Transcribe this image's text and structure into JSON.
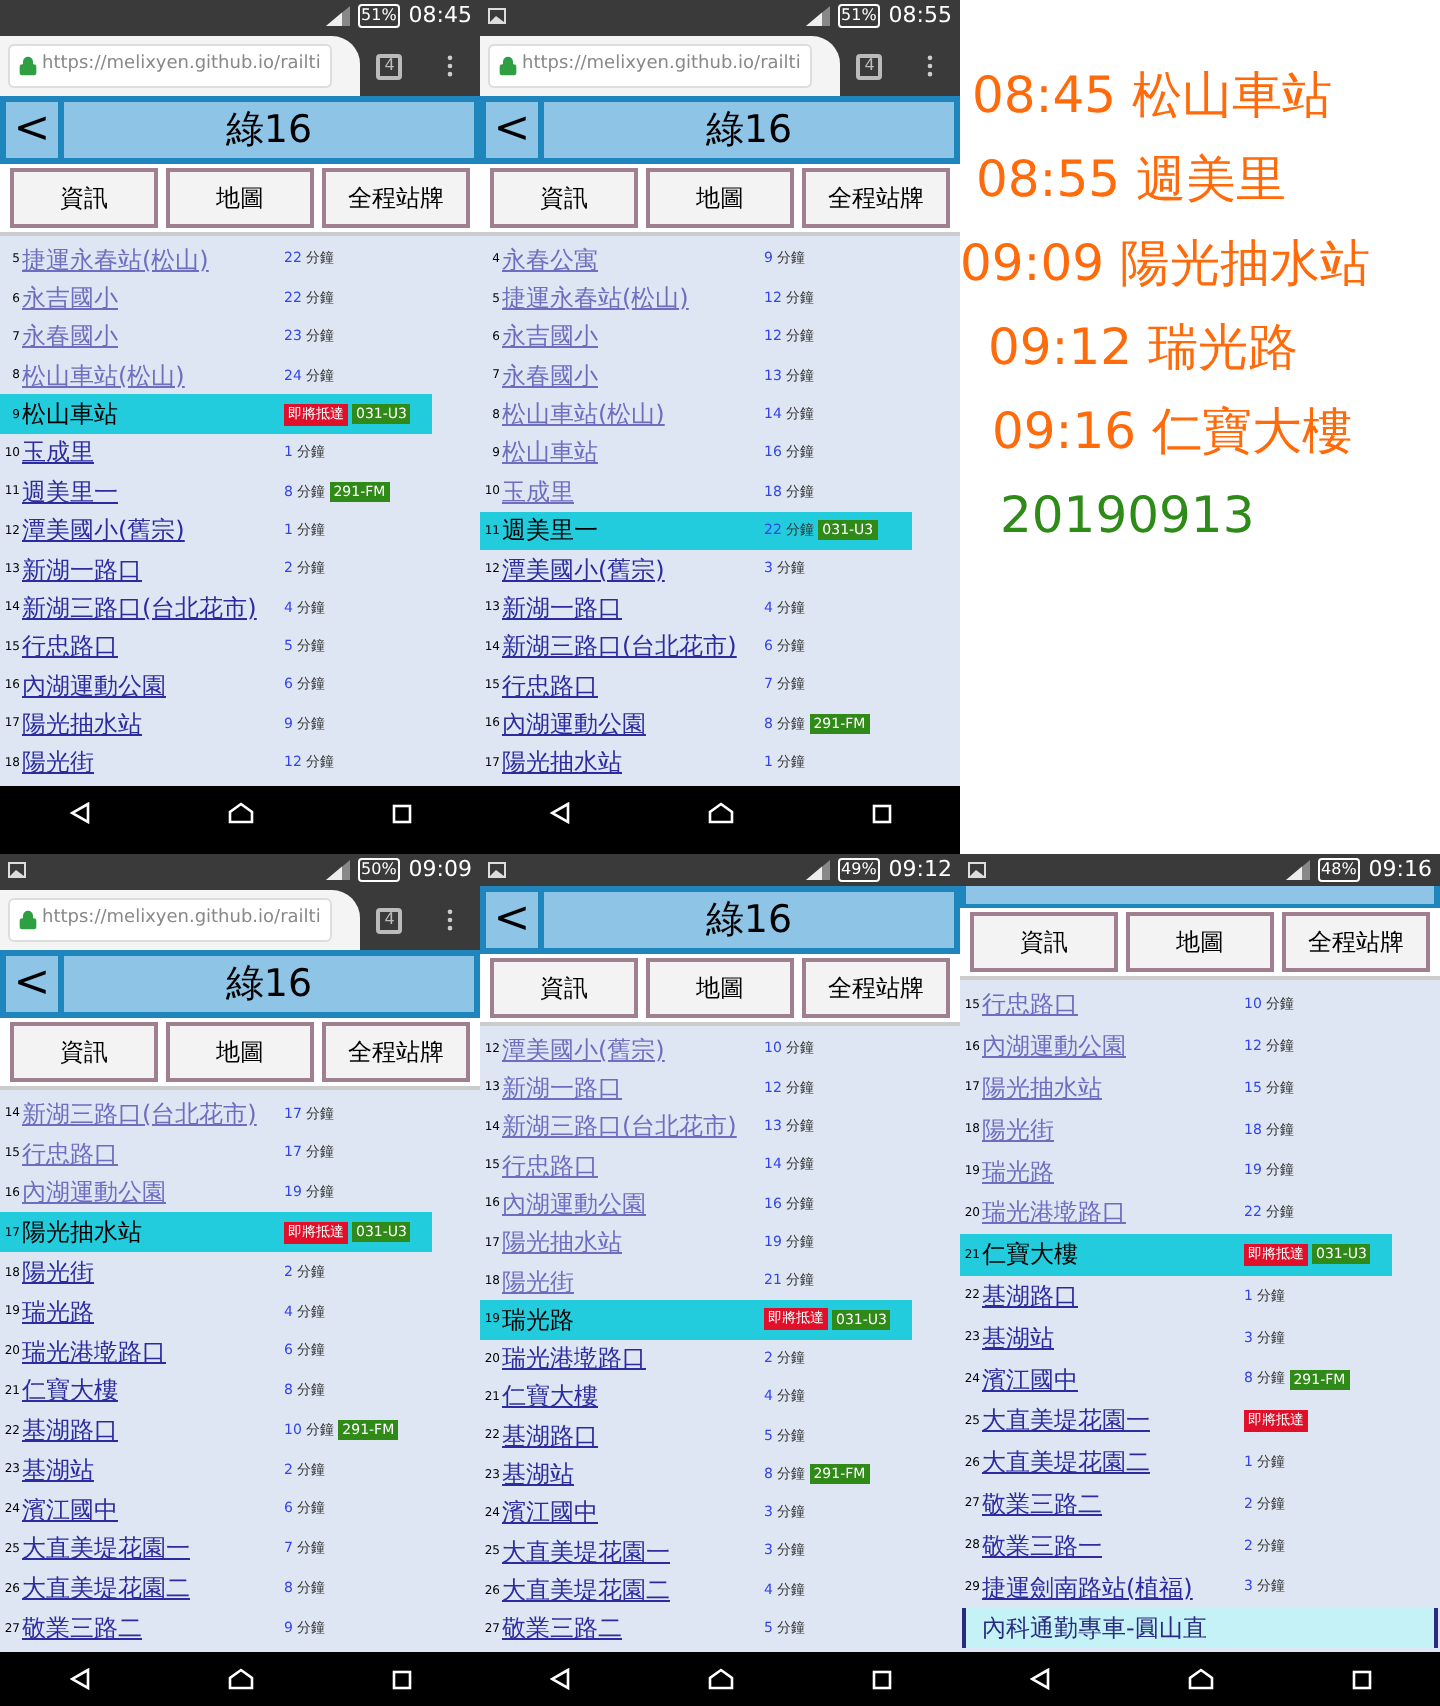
{
  "screenshots": [
    {
      "status": {
        "time": "08:45",
        "battery": "51%",
        "image_icon": false
      },
      "url_bar": {
        "url": "https://melixyen.github.io/railti",
        "tabs": "4"
      },
      "header": {
        "back": "<",
        "title": "綠16"
      },
      "buttons": [
        "資訊",
        "地圖",
        "全程站牌"
      ],
      "stops": [
        {
          "no": "5",
          "name": "捷運永春站(松山)",
          "visited": true,
          "selected": false,
          "eta": "22",
          "unit": "分鐘"
        },
        {
          "no": "6",
          "name": "永吉國小",
          "visited": true,
          "selected": false,
          "eta": "22",
          "unit": "分鐘"
        },
        {
          "no": "7",
          "name": "永春國小",
          "visited": true,
          "selected": false,
          "eta": "23",
          "unit": "分鐘"
        },
        {
          "no": "8",
          "name": "松山車站(松山)",
          "visited": true,
          "selected": false,
          "eta": "24",
          "unit": "分鐘"
        },
        {
          "no": "9",
          "name": "松山車站",
          "selected": true,
          "arriving": "即將抵達",
          "plate": "031-U3"
        },
        {
          "no": "10",
          "name": "玉成里",
          "visited": false,
          "selected": false,
          "eta": "1",
          "unit": "分鐘"
        },
        {
          "no": "11",
          "name": "週美里一",
          "visited": false,
          "selected": false,
          "eta": "8",
          "unit": "分鐘",
          "plate": "291-FM"
        },
        {
          "no": "12",
          "name": "潭美國小(舊宗)",
          "visited": false,
          "selected": false,
          "eta": "1",
          "unit": "分鐘"
        },
        {
          "no": "13",
          "name": "新湖一路口",
          "visited": false,
          "selected": false,
          "eta": "2",
          "unit": "分鐘"
        },
        {
          "no": "14",
          "name": "新湖三路口(台北花市)",
          "visited": false,
          "selected": false,
          "eta": "4",
          "unit": "分鐘"
        },
        {
          "no": "15",
          "name": "行忠路口",
          "visited": false,
          "selected": false,
          "eta": "5",
          "unit": "分鐘"
        },
        {
          "no": "16",
          "name": "內湖運動公園",
          "visited": false,
          "selected": false,
          "eta": "6",
          "unit": "分鐘"
        },
        {
          "no": "17",
          "name": "陽光抽水站",
          "visited": false,
          "selected": false,
          "eta": "9",
          "unit": "分鐘"
        },
        {
          "no": "18",
          "name": "陽光街",
          "visited": false,
          "selected": false,
          "eta": "12",
          "unit": "分鐘"
        }
      ]
    },
    {
      "status": {
        "time": "08:55",
        "battery": "51%",
        "image_icon": true
      },
      "url_bar": {
        "url": "https://melixyen.github.io/railti",
        "tabs": "4"
      },
      "header": {
        "back": "<",
        "title": "綠16"
      },
      "buttons": [
        "資訊",
        "地圖",
        "全程站牌"
      ],
      "stops": [
        {
          "no": "4",
          "name": "永春公寓",
          "visited": true,
          "selected": false,
          "eta": "9",
          "unit": "分鐘"
        },
        {
          "no": "5",
          "name": "捷運永春站(松山)",
          "visited": true,
          "selected": false,
          "eta": "12",
          "unit": "分鐘"
        },
        {
          "no": "6",
          "name": "永吉國小",
          "visited": true,
          "selected": false,
          "eta": "12",
          "unit": "分鐘"
        },
        {
          "no": "7",
          "name": "永春國小",
          "visited": true,
          "selected": false,
          "eta": "13",
          "unit": "分鐘"
        },
        {
          "no": "8",
          "name": "松山車站(松山)",
          "visited": true,
          "selected": false,
          "eta": "14",
          "unit": "分鐘"
        },
        {
          "no": "9",
          "name": "松山車站",
          "visited": true,
          "selected": false,
          "eta": "16",
          "unit": "分鐘"
        },
        {
          "no": "10",
          "name": "玉成里",
          "visited": true,
          "selected": false,
          "eta": "18",
          "unit": "分鐘"
        },
        {
          "no": "11",
          "name": "週美里一",
          "selected": true,
          "eta": "22",
          "unit": "分鐘",
          "plate": "031-U3"
        },
        {
          "no": "12",
          "name": "潭美國小(舊宗)",
          "visited": false,
          "selected": false,
          "eta": "3",
          "unit": "分鐘"
        },
        {
          "no": "13",
          "name": "新湖一路口",
          "visited": false,
          "selected": false,
          "eta": "4",
          "unit": "分鐘"
        },
        {
          "no": "14",
          "name": "新湖三路口(台北花市)",
          "visited": false,
          "selected": false,
          "eta": "6",
          "unit": "分鐘"
        },
        {
          "no": "15",
          "name": "行忠路口",
          "visited": false,
          "selected": false,
          "eta": "7",
          "unit": "分鐘"
        },
        {
          "no": "16",
          "name": "內湖運動公園",
          "visited": false,
          "selected": false,
          "eta": "8",
          "unit": "分鐘",
          "plate": "291-FM"
        },
        {
          "no": "17",
          "name": "陽光抽水站",
          "visited": false,
          "selected": false,
          "eta": "1",
          "unit": "分鐘"
        }
      ]
    },
    {
      "status": {
        "time": "09:09",
        "battery": "50%",
        "image_icon": true
      },
      "url_bar": {
        "url": "https://melixyen.github.io/railti",
        "tabs": "4"
      },
      "header": {
        "back": "<",
        "title": "綠16"
      },
      "buttons": [
        "資訊",
        "地圖",
        "全程站牌"
      ],
      "stops": [
        {
          "no": "14",
          "name": "新湖三路口(台北花市)",
          "visited": true,
          "selected": false,
          "eta": "17",
          "unit": "分鐘"
        },
        {
          "no": "15",
          "name": "行忠路口",
          "visited": true,
          "selected": false,
          "eta": "17",
          "unit": "分鐘"
        },
        {
          "no": "16",
          "name": "內湖運動公園",
          "visited": true,
          "selected": false,
          "eta": "19",
          "unit": "分鐘"
        },
        {
          "no": "17",
          "name": "陽光抽水站",
          "selected": true,
          "arriving": "即將抵達",
          "plate": "031-U3"
        },
        {
          "no": "18",
          "name": "陽光街",
          "visited": false,
          "selected": false,
          "eta": "2",
          "unit": "分鐘"
        },
        {
          "no": "19",
          "name": "瑞光路",
          "visited": false,
          "selected": false,
          "eta": "4",
          "unit": "分鐘"
        },
        {
          "no": "20",
          "name": "瑞光港墘路口",
          "visited": false,
          "selected": false,
          "eta": "6",
          "unit": "分鐘"
        },
        {
          "no": "21",
          "name": "仁寶大樓",
          "visited": false,
          "selected": false,
          "eta": "8",
          "unit": "分鐘"
        },
        {
          "no": "22",
          "name": "基湖路口",
          "visited": false,
          "selected": false,
          "eta": "10",
          "unit": "分鐘",
          "plate": "291-FM"
        },
        {
          "no": "23",
          "name": "基湖站",
          "visited": false,
          "selected": false,
          "eta": "2",
          "unit": "分鐘"
        },
        {
          "no": "24",
          "name": "濱江國中",
          "visited": false,
          "selected": false,
          "eta": "6",
          "unit": "分鐘"
        },
        {
          "no": "25",
          "name": "大直美堤花園一",
          "visited": false,
          "selected": false,
          "eta": "7",
          "unit": "分鐘"
        },
        {
          "no": "26",
          "name": "大直美堤花園二",
          "visited": false,
          "selected": false,
          "eta": "8",
          "unit": "分鐘"
        },
        {
          "no": "27",
          "name": "敬業三路二",
          "visited": false,
          "selected": false,
          "eta": "9",
          "unit": "分鐘"
        }
      ]
    },
    {
      "status": {
        "time": "09:12",
        "battery": "49%",
        "image_icon": true
      },
      "header": {
        "back": "<",
        "title": "綠16"
      },
      "buttons": [
        "資訊",
        "地圖",
        "全程站牌"
      ],
      "stops": [
        {
          "no": "12",
          "name": "潭美國小(舊宗)",
          "visited": true,
          "selected": false,
          "eta": "10",
          "unit": "分鐘"
        },
        {
          "no": "13",
          "name": "新湖一路口",
          "visited": true,
          "selected": false,
          "eta": "12",
          "unit": "分鐘"
        },
        {
          "no": "14",
          "name": "新湖三路口(台北花市)",
          "visited": true,
          "selected": false,
          "eta": "13",
          "unit": "分鐘"
        },
        {
          "no": "15",
          "name": "行忠路口",
          "visited": true,
          "selected": false,
          "eta": "14",
          "unit": "分鐘"
        },
        {
          "no": "16",
          "name": "內湖運動公園",
          "visited": true,
          "selected": false,
          "eta": "16",
          "unit": "分鐘"
        },
        {
          "no": "17",
          "name": "陽光抽水站",
          "visited": true,
          "selected": false,
          "eta": "19",
          "unit": "分鐘"
        },
        {
          "no": "18",
          "name": "陽光街",
          "visited": true,
          "selected": false,
          "eta": "21",
          "unit": "分鐘"
        },
        {
          "no": "19",
          "name": "瑞光路",
          "selected": true,
          "arriving": "即將抵達",
          "plate": "031-U3"
        },
        {
          "no": "20",
          "name": "瑞光港墘路口",
          "visited": false,
          "selected": false,
          "eta": "2",
          "unit": "分鐘"
        },
        {
          "no": "21",
          "name": "仁寶大樓",
          "visited": false,
          "selected": false,
          "eta": "4",
          "unit": "分鐘"
        },
        {
          "no": "22",
          "name": "基湖路口",
          "visited": false,
          "selected": false,
          "eta": "5",
          "unit": "分鐘"
        },
        {
          "no": "23",
          "name": "基湖站",
          "visited": false,
          "selected": false,
          "eta": "8",
          "unit": "分鐘",
          "plate": "291-FM"
        },
        {
          "no": "24",
          "name": "濱江國中",
          "visited": false,
          "selected": false,
          "eta": "3",
          "unit": "分鐘"
        },
        {
          "no": "25",
          "name": "大直美堤花園一",
          "visited": false,
          "selected": false,
          "eta": "3",
          "unit": "分鐘"
        },
        {
          "no": "26",
          "name": "大直美堤花園二",
          "visited": false,
          "selected": false,
          "eta": "4",
          "unit": "分鐘"
        },
        {
          "no": "27",
          "name": "敬業三路二",
          "visited": false,
          "selected": false,
          "eta": "5",
          "unit": "分鐘"
        }
      ]
    },
    {
      "status": {
        "time": "09:16",
        "battery": "48%",
        "image_icon": true
      },
      "header_strip": true,
      "buttons": [
        "資訊",
        "地圖",
        "全程站牌"
      ],
      "stops": [
        {
          "no": "15",
          "name": "行忠路口",
          "visited": true,
          "selected": false,
          "eta": "10",
          "unit": "分鐘"
        },
        {
          "no": "16",
          "name": "內湖運動公園",
          "visited": true,
          "selected": false,
          "eta": "12",
          "unit": "分鐘"
        },
        {
          "no": "17",
          "name": "陽光抽水站",
          "visited": true,
          "selected": false,
          "eta": "15",
          "unit": "分鐘"
        },
        {
          "no": "18",
          "name": "陽光街",
          "visited": true,
          "selected": false,
          "eta": "18",
          "unit": "分鐘"
        },
        {
          "no": "19",
          "name": "瑞光路",
          "visited": true,
          "selected": false,
          "eta": "19",
          "unit": "分鐘"
        },
        {
          "no": "20",
          "name": "瑞光港墘路口",
          "visited": true,
          "selected": false,
          "eta": "22",
          "unit": "分鐘"
        },
        {
          "no": "21",
          "name": "仁寶大樓",
          "selected": true,
          "arriving": "即將抵達",
          "plate": "031-U3"
        },
        {
          "no": "22",
          "name": "基湖路口",
          "visited": false,
          "selected": false,
          "eta": "1",
          "unit": "分鐘"
        },
        {
          "no": "23",
          "name": "基湖站",
          "visited": false,
          "selected": false,
          "eta": "3",
          "unit": "分鐘"
        },
        {
          "no": "24",
          "name": "濱江國中",
          "visited": false,
          "selected": false,
          "eta": "8",
          "unit": "分鐘",
          "plate": "291-FM"
        },
        {
          "no": "25",
          "name": "大直美堤花園一",
          "visited": false,
          "selected": false,
          "arriving": "即將抵達"
        },
        {
          "no": "26",
          "name": "大直美堤花園二",
          "visited": false,
          "selected": false,
          "eta": "1",
          "unit": "分鐘"
        },
        {
          "no": "27",
          "name": "敬業三路二",
          "visited": false,
          "selected": false,
          "eta": "2",
          "unit": "分鐘"
        },
        {
          "no": "28",
          "name": "敬業三路一",
          "visited": false,
          "selected": false,
          "eta": "2",
          "unit": "分鐘"
        },
        {
          "no": "29",
          "name": "捷運劍南路站(植福)",
          "visited": false,
          "selected": false,
          "eta": "3",
          "unit": "分鐘"
        }
      ],
      "route_banner": "內科通勤專車-圓山直"
    }
  ],
  "notes": {
    "entries": [
      {
        "time": "08:45",
        "station": "松山車站"
      },
      {
        "time": "08:55",
        "station": "週美里"
      },
      {
        "time": "09:09",
        "station": "陽光抽水站"
      },
      {
        "time": "09:12",
        "station": "瑞光路"
      },
      {
        "time": "09:16",
        "station": "仁寶大樓"
      }
    ],
    "date": "20190913"
  }
}
